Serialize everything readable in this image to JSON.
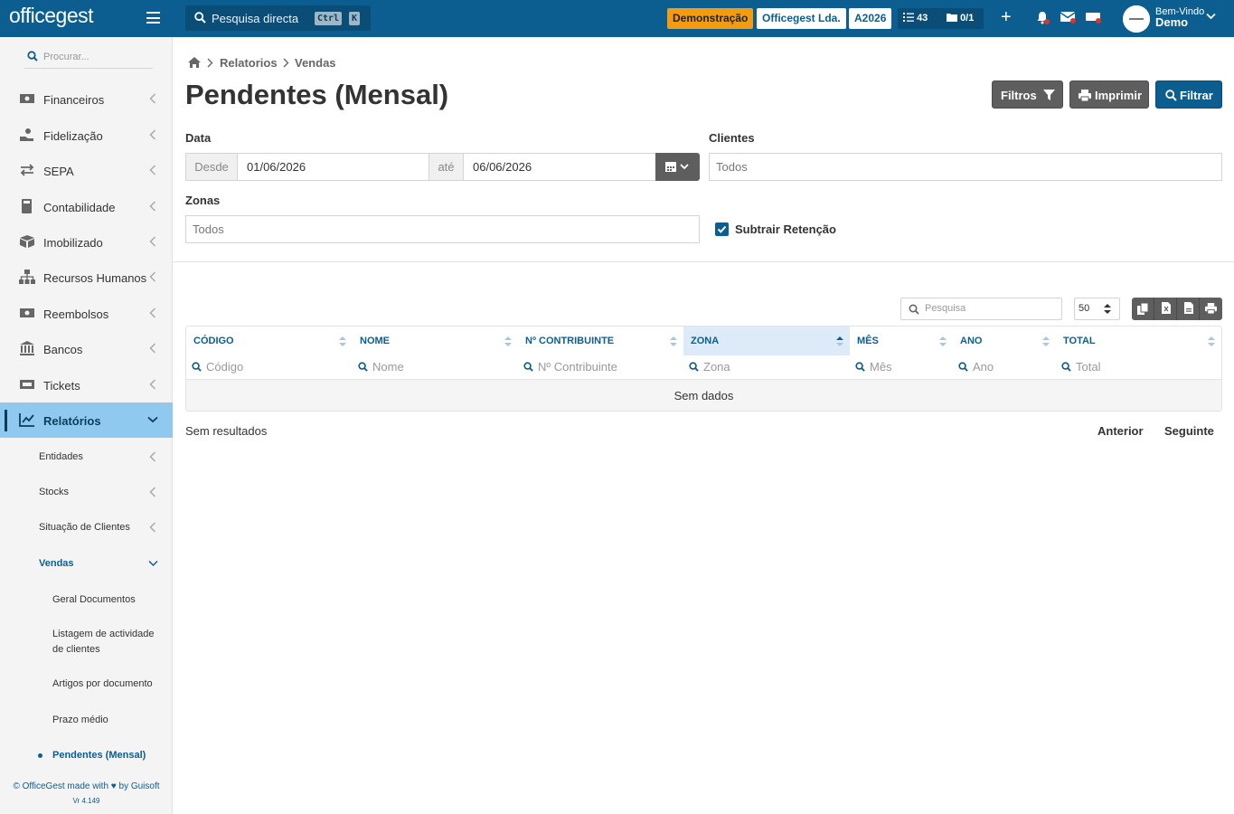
{
  "topbar": {
    "logo": "officegest",
    "search_placeholder": "Pesquisa directa",
    "kbd_ctrl": "Ctrl",
    "kbd_k": "K",
    "badge_demo": "Demonstração",
    "badge_company": "Officegest Lda.",
    "badge_year": "A2026",
    "tasks_count": "43",
    "docs_count": "0/1",
    "plus_label": "+",
    "welcome": "Bem-Vindo",
    "user": "Demo"
  },
  "sidebar": {
    "search_placeholder": "Procurar...",
    "items": [
      {
        "label": "Financeiros",
        "icon": "money-icon"
      },
      {
        "label": "Fidelização",
        "icon": "hand-coin-icon"
      },
      {
        "label": "SEPA",
        "icon": "exchange-icon"
      },
      {
        "label": "Contabilidade",
        "icon": "calculator-icon"
      },
      {
        "label": "Imobilizado",
        "icon": "boxes-icon"
      },
      {
        "label": "Recursos Humanos",
        "icon": "sitemap-icon"
      },
      {
        "label": "Reembolsos",
        "icon": "money-icon"
      },
      {
        "label": "Bancos",
        "icon": "bank-icon"
      },
      {
        "label": "Tickets",
        "icon": "ticket-icon"
      },
      {
        "label": "Relatórios",
        "icon": "chart-icon"
      }
    ],
    "sub_items": [
      "Entidades",
      "Stocks",
      "Situação de Clientes",
      "Vendas"
    ],
    "vendas_items": [
      "Geral Documentos",
      "Listagem de actividade de clientes",
      "Artigos por documento",
      "Prazo médio",
      "Pendentes (Mensal)"
    ],
    "footer": "© OfficeGest made with ♥ by Guisoft",
    "version": "Vr 4.149"
  },
  "breadcrumb": {
    "level1": "Relatorios",
    "level2": "Vendas"
  },
  "page": {
    "title": "Pendentes (Mensal)",
    "btn_filtros": "Filtros",
    "btn_imprimir": "Imprimir",
    "btn_filtrar": "Filtrar"
  },
  "form": {
    "data_label": "Data",
    "desde_label": "Desde",
    "desde_value": "01/06/2026",
    "ate_label": "até",
    "ate_value": "06/06/2026",
    "clientes_label": "Clientes",
    "clientes_value": "Todos",
    "zonas_label": "Zonas",
    "zonas_value": "Todos",
    "subtrair_label": "Subtrair Retenção",
    "subtrair_checked": true
  },
  "table": {
    "search_placeholder": "Pesquisa",
    "page_size": "50",
    "columns": [
      "CÓDIGO",
      "NOME",
      "Nº CONTRIBUINTE",
      "ZONA",
      "MÊS",
      "ANO",
      "TOTAL"
    ],
    "filters": [
      "Código",
      "Nome",
      "Nº Contribuinte",
      "Zona",
      "Mês",
      "Ano",
      "Total"
    ],
    "sorted_column": "ZONA",
    "empty_text": "Sem dados",
    "results_text": "Sem resultados",
    "prev_label": "Anterior",
    "next_label": "Seguinte"
  },
  "colors": {
    "brand": "#0b5e8f",
    "active_menu": "#8fc9ef",
    "demo_badge": "#f39c12"
  }
}
